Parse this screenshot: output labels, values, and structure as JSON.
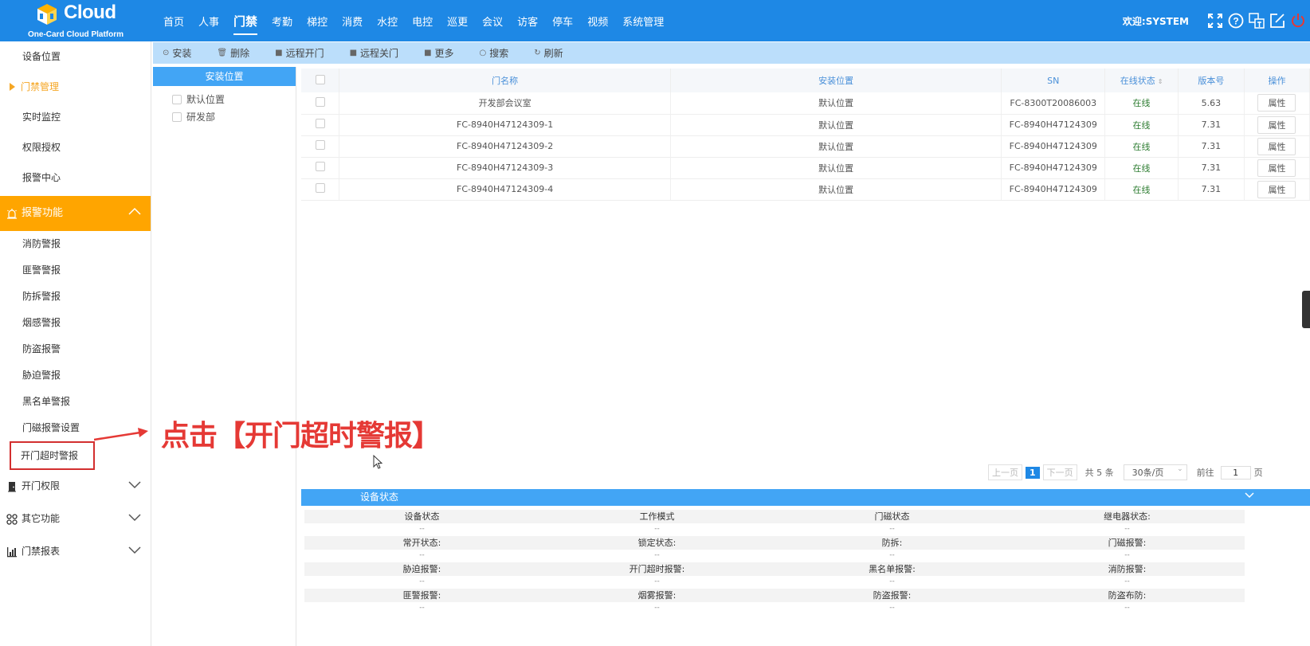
{
  "header": {
    "logo_text": "Cloud",
    "logo_subtitle": "One-Card Cloud Platform",
    "nav": [
      "首页",
      "人事",
      "门禁",
      "考勤",
      "梯控",
      "消费",
      "水控",
      "电控",
      "巡更",
      "会议",
      "访客",
      "停车",
      "视频",
      "系统管理"
    ],
    "active_nav": "门禁",
    "welcome": "欢迎:SYSTEM",
    "icons": [
      "fullscreen-icon",
      "help-icon",
      "language-icon",
      "edit-icon",
      "power-icon"
    ]
  },
  "sidebar": {
    "items": [
      "设备位置",
      "门禁管理",
      "实时监控",
      "权限授权",
      "报警中心"
    ],
    "alarm_group": "报警功能",
    "alarm_items": [
      "消防警报",
      "匪警警报",
      "防拆警报",
      "烟感警报",
      "防盗报警",
      "胁迫警报",
      "黑名单警报",
      "门磁报警设置",
      "开门超时警报"
    ],
    "groups": [
      "开门权限",
      "其它功能",
      "门禁报表"
    ]
  },
  "toolbar": {
    "buttons": [
      "安装",
      "删除",
      "远程开门",
      "远程关门",
      "更多",
      "搜索",
      "刷新"
    ]
  },
  "location_panel": {
    "title": "安装位置",
    "items": [
      "默认位置",
      "研发部"
    ]
  },
  "table": {
    "columns": [
      "门名称",
      "安装位置",
      "SN",
      "在线状态",
      "版本号",
      "操作"
    ],
    "rows": [
      {
        "name": "开发部会议室",
        "location": "默认位置",
        "sn": "FC-8300T20086003",
        "status": "在线",
        "version": "5.63",
        "action": "属性"
      },
      {
        "name": "FC-8940H47124309-1",
        "location": "默认位置",
        "sn": "FC-8940H47124309",
        "status": "在线",
        "version": "7.31",
        "action": "属性"
      },
      {
        "name": "FC-8940H47124309-2",
        "location": "默认位置",
        "sn": "FC-8940H47124309",
        "status": "在线",
        "version": "7.31",
        "action": "属性"
      },
      {
        "name": "FC-8940H47124309-3",
        "location": "默认位置",
        "sn": "FC-8940H47124309",
        "status": "在线",
        "version": "7.31",
        "action": "属性"
      },
      {
        "name": "FC-8940H47124309-4",
        "location": "默认位置",
        "sn": "FC-8940H47124309",
        "status": "在线",
        "version": "7.31",
        "action": "属性"
      }
    ]
  },
  "pagination": {
    "prev": "上一页",
    "current_page": "1",
    "next": "下一页",
    "total": "共 5 条",
    "page_size": "30条/页",
    "goto": "前往",
    "goto_value": "1",
    "page_suffix": "页"
  },
  "device_status": {
    "title": "设备状态",
    "rows": [
      [
        "设备状态",
        "工作模式",
        "门磁状态",
        "继电器状态:"
      ],
      [
        "常开状态:",
        "锁定状态:",
        "防拆:",
        "门磁报警:"
      ],
      [
        "胁迫报警:",
        "开门超时报警:",
        "黑名单报警:",
        "消防报警:"
      ],
      [
        "匪警报警:",
        "烟雾报警:",
        "防盗报警:",
        "防盗布防:"
      ]
    ],
    "placeholder": "--"
  },
  "annotation": {
    "text": "点击【开门超时警报】"
  },
  "colors": {
    "primary": "#1e88e5",
    "alarm_group": "#ffa500",
    "annotation": "#e53935",
    "online": "#2e7d32"
  }
}
